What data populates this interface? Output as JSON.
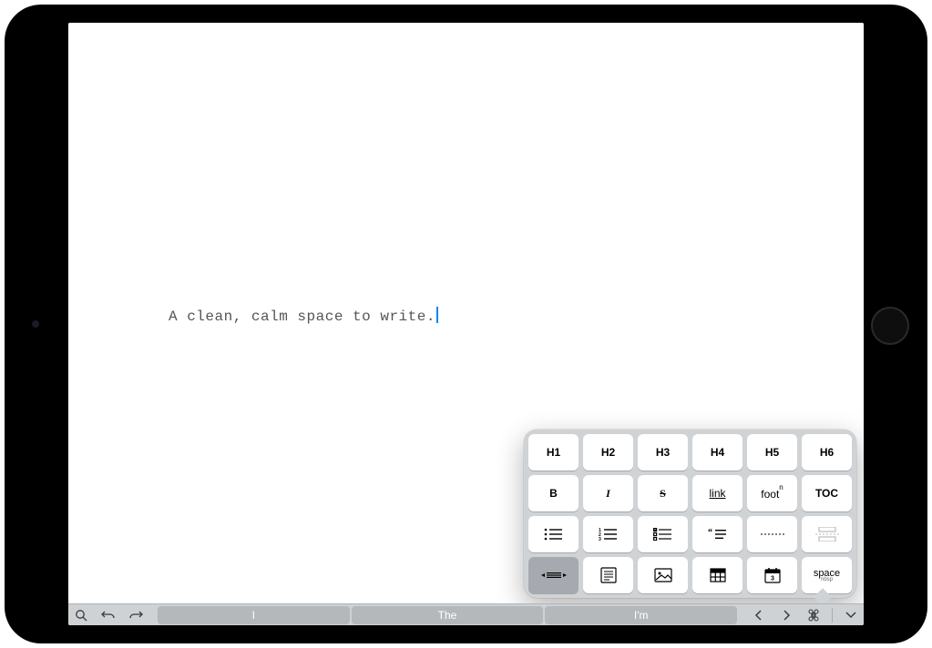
{
  "editor": {
    "content": "A clean, calm space to write."
  },
  "format_panel": {
    "row1": [
      "H1",
      "H2",
      "H3",
      "H4",
      "H5",
      "H6"
    ],
    "row2": {
      "bold": "B",
      "italic": "I",
      "strike": "S",
      "link": "link",
      "footnote": "foot",
      "footnote_sup": "n",
      "toc": "TOC"
    },
    "row4": {
      "space": "space",
      "space_sub": "nbsp"
    },
    "date_day": "3"
  },
  "bottom_bar": {
    "predictions": [
      "I",
      "The",
      "I'm"
    ]
  }
}
